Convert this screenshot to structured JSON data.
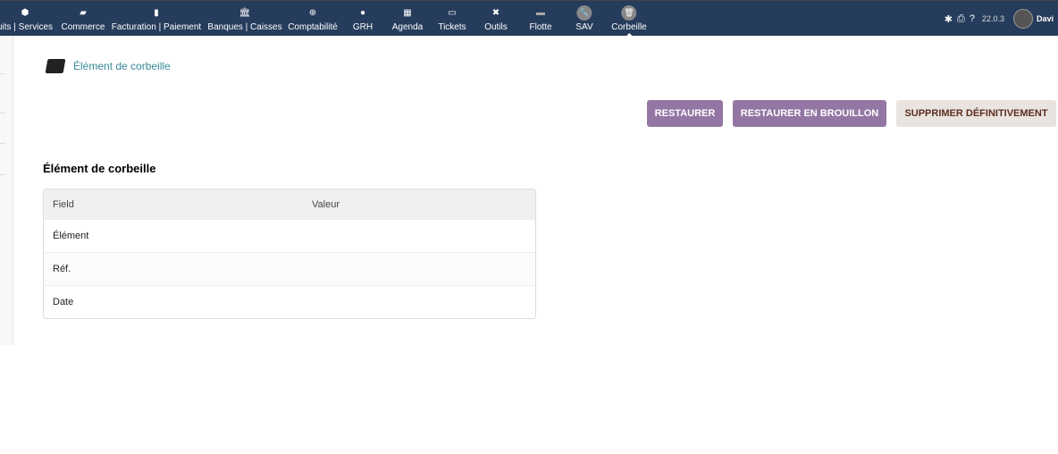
{
  "topnav": {
    "items": [
      {
        "label": "uits | Services",
        "icon": "cube-icon"
      },
      {
        "label": "Commerce",
        "icon": "briefcase-icon"
      },
      {
        "label": "Facturation | Paiement",
        "icon": "invoice-icon"
      },
      {
        "label": "Banques | Caisses",
        "icon": "bank-icon"
      },
      {
        "label": "Comptabilité",
        "icon": "search-dollar-icon"
      },
      {
        "label": "GRH",
        "icon": "user-icon"
      },
      {
        "label": "Agenda",
        "icon": "calendar-icon"
      },
      {
        "label": "Tickets",
        "icon": "ticket-icon"
      },
      {
        "label": "Outils",
        "icon": "tools-icon"
      },
      {
        "label": "Flotte",
        "icon": "car-icon"
      },
      {
        "label": "SAV",
        "icon": "wrench-icon"
      },
      {
        "label": "Corbeille",
        "icon": "trash-icon",
        "active": true
      }
    ],
    "version": "22.0.3",
    "user": "Davi"
  },
  "breadcrumb": {
    "title": "Élément de corbeille"
  },
  "actions": {
    "restore": "RESTAURER",
    "restore_draft": "RESTAURER EN BROUILLON",
    "delete": "SUPPRIMER DÉFINITIVEMENT"
  },
  "colors": {
    "topbar": "#263c5c",
    "primary_button": "#9376a4",
    "danger_button": "#eae4e1"
  },
  "section": {
    "title": "Élément de corbeille",
    "table": {
      "headers": [
        "Field",
        "Valeur"
      ],
      "rows": [
        [
          "Élément",
          ""
        ],
        [
          "Réf.",
          ""
        ],
        [
          "Date",
          ""
        ]
      ]
    }
  }
}
